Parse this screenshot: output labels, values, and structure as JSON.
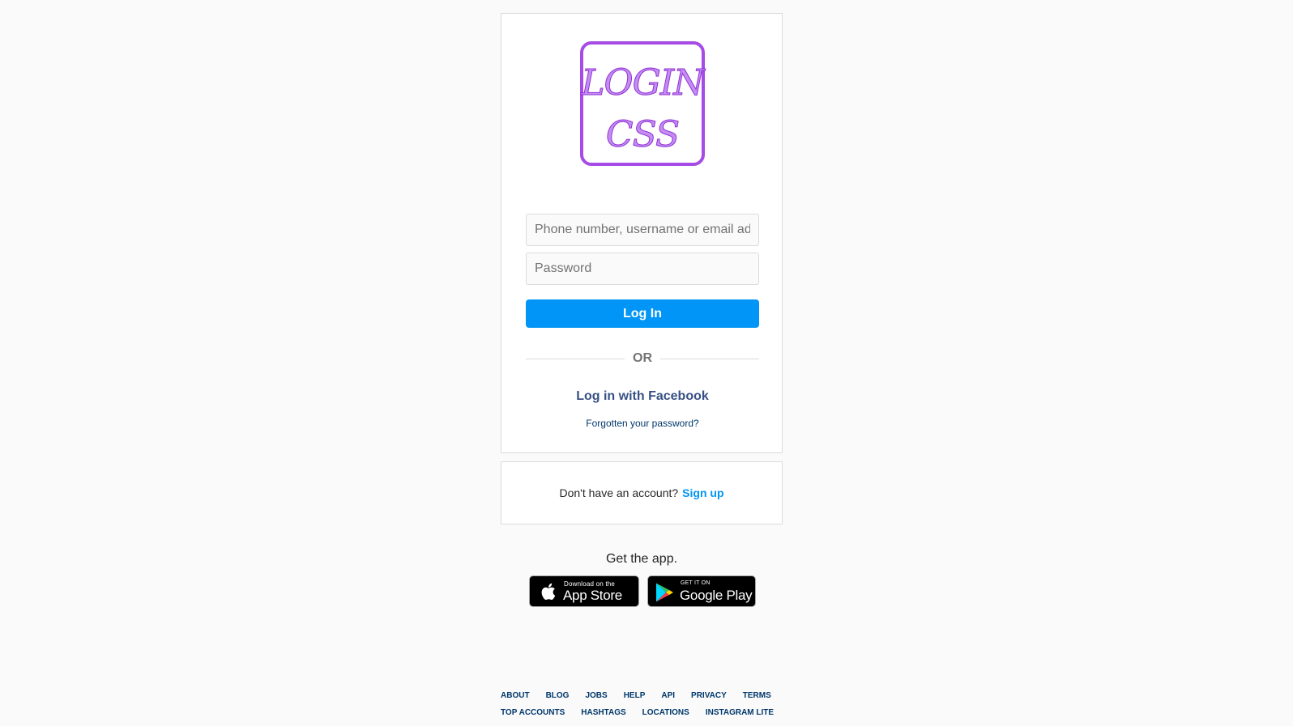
{
  "login": {
    "logo_alt": "LOGIN CSS",
    "logo_line1": "LOGIN",
    "logo_line2": "CSS",
    "username_placeholder": "Phone number, username or email address",
    "password_placeholder": "Password",
    "login_button": "Log In",
    "or_text": "OR",
    "facebook_link": "Log in with Facebook",
    "forgot_link": "Forgotten your password?"
  },
  "signup": {
    "prompt": "Don't have an account?",
    "link": "Sign up"
  },
  "app": {
    "heading": "Get the app.",
    "apple_small": "Download on the",
    "apple_big": "App Store",
    "google_small": "GET IT ON",
    "google_big": "Google Play"
  },
  "footer": {
    "row1": [
      "ABOUT",
      "BLOG",
      "JOBS",
      "HELP",
      "API",
      "PRIVACY",
      "TERMS"
    ],
    "row2": [
      "TOP ACCOUNTS",
      "HASHTAGS",
      "LOCATIONS",
      "INSTAGRAM LITE"
    ]
  },
  "colors": {
    "accent": "#0095f6",
    "facebook": "#385185",
    "logo": "#a64be6"
  },
  "icons": {
    "apple": "apple-icon",
    "google": "google-play-icon"
  }
}
